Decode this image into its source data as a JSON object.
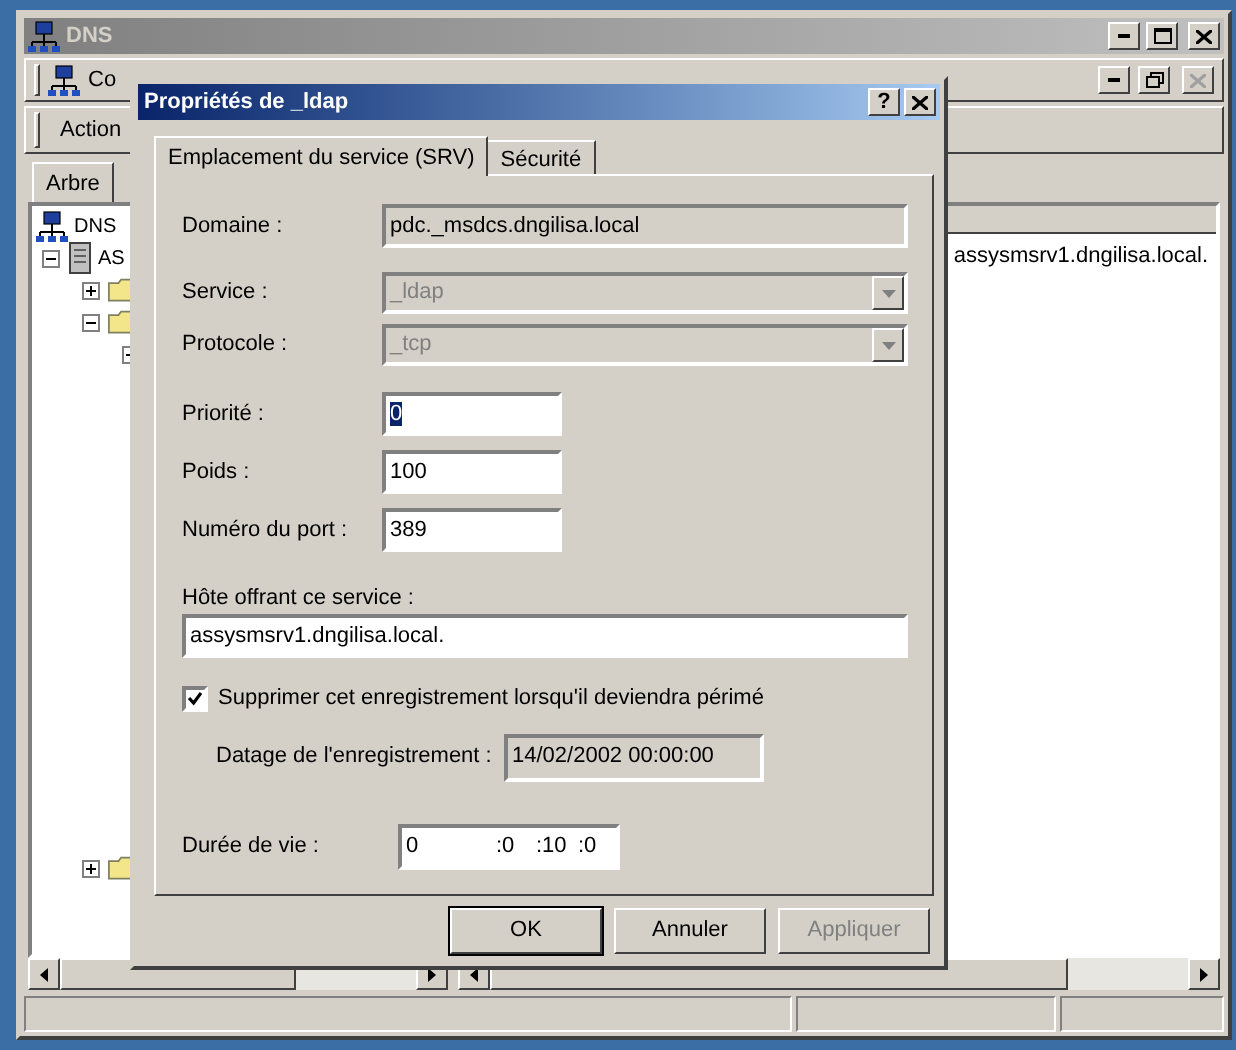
{
  "main_window": {
    "title": "DNS",
    "child_title": "Co",
    "menu": [
      "Action"
    ],
    "tab": "Arbre",
    "tree": [
      {
        "label": "DNS",
        "kind": "dns",
        "children": [
          {
            "label": "AS",
            "kind": "server",
            "expanded": true,
            "children": [
              {
                "kind": "folder",
                "expanded": false
              },
              {
                "kind": "folder",
                "expanded": true,
                "children": [
                  {
                    "expanded": true
                  }
                ]
              },
              {
                "kind": "folder",
                "expanded": false
              }
            ]
          }
        ]
      }
    ],
    "details_text": "assysmsrv1.dngilisa.local."
  },
  "dialog": {
    "title": "Propriétés de _ldap",
    "help_button": "?",
    "tabs": [
      {
        "label": "Emplacement du service (SRV)",
        "selected": true
      },
      {
        "label": "Sécurité",
        "selected": false
      }
    ],
    "fields": [
      {
        "kind": "readonly",
        "label": "Domaine :",
        "value": "pdc._msdcs.dngilisa.local"
      },
      {
        "kind": "dropdown",
        "label": "Service :",
        "value": "_ldap",
        "disabled": true
      },
      {
        "kind": "dropdown",
        "label": "Protocole :",
        "value": "_tcp",
        "disabled": true
      },
      {
        "kind": "text",
        "label": "Priorité :",
        "value": "0",
        "highlighted": true
      },
      {
        "kind": "text",
        "label": "Poids :",
        "value": "100",
        "highlighted": false
      },
      {
        "kind": "text",
        "label": "Numéro du port :",
        "value": "389",
        "highlighted": false
      }
    ],
    "host": {
      "label": "Hôte offrant ce service :",
      "value": "assysmsrv1.dngilisa.local."
    },
    "delete_stale": {
      "label": "Supprimer cet enregistrement lorsqu'il deviendra périmé",
      "checked": true
    },
    "timestamp": {
      "label": "Datage de l'enregistrement :",
      "value": "14/02/2002 00:00:00"
    },
    "ttl": {
      "label": "Durée de vie :",
      "parts": [
        "0",
        ":0",
        ":10",
        ":0"
      ]
    },
    "buttons": [
      {
        "label": "OK",
        "default": true,
        "disabled": false
      },
      {
        "label": "Annuler",
        "default": false,
        "disabled": false
      },
      {
        "label": "Appliquer",
        "default": false,
        "disabled": true
      }
    ]
  }
}
